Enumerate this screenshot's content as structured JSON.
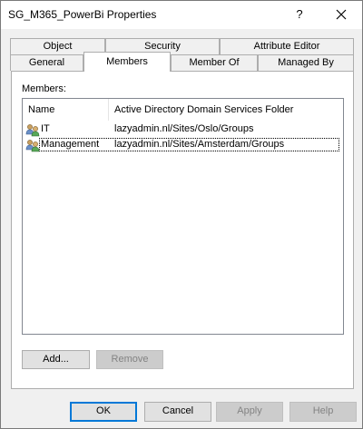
{
  "window": {
    "title": "SG_M365_PowerBi Properties",
    "help_glyph": "?",
    "close_icon": "close-icon"
  },
  "tabs": {
    "row_back": [
      "Object",
      "Security",
      "Attribute Editor"
    ],
    "row_front": [
      "General",
      "Members",
      "Member Of",
      "Managed By"
    ],
    "active": "Members"
  },
  "members": {
    "label": "Members:",
    "columns": [
      "Name",
      "Active Directory Domain Services Folder"
    ],
    "rows": [
      {
        "icon": "group-icon",
        "name": "IT",
        "folder": "lazyadmin.nl/Sites/Oslo/Groups"
      },
      {
        "icon": "group-icon",
        "name": "Management",
        "folder": "lazyadmin.nl/Sites/Amsterdam/Groups"
      }
    ],
    "add_label": "Add...",
    "remove_label": "Remove"
  },
  "footer": {
    "ok": "OK",
    "cancel": "Cancel",
    "apply": "Apply",
    "help": "Help"
  },
  "colors": {
    "accent": "#0078d7",
    "disabled_text": "#838383"
  }
}
